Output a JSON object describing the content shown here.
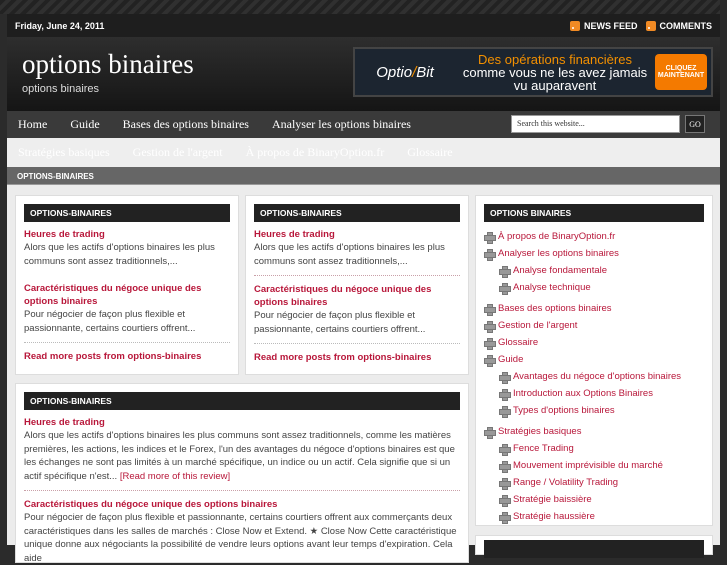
{
  "topbar": {
    "date": "Friday, June 24, 2011",
    "news_feed": "NEWS FEED",
    "comments": "COMMENTS"
  },
  "header": {
    "title": "options binaires",
    "tagline": "options binaires"
  },
  "ad": {
    "logo_a": "Optio",
    "logo_b": "Bit",
    "line1": "Des opérations financières",
    "line2": "comme vous ne les avez jamais",
    "line3": "vu auparavent",
    "button": "CLIQUEZ MAINTENANT"
  },
  "nav": {
    "items": [
      "Home",
      "Guide",
      "Bases des options binaires",
      "Analyser les options binaires"
    ],
    "search_placeholder": "Search this website...",
    "go": "GO"
  },
  "subnav": {
    "items": [
      "Stratégies basiques",
      "Gestion de l'argent",
      "À propos de BinaryOption.fr",
      "Glossaire"
    ]
  },
  "breadcrumb": "OPTIONS-BINAIRES",
  "box_small": {
    "heading": "OPTIONS-BINAIRES",
    "post1_title": "Heures de trading",
    "post1_excerpt": "Alors que les actifs d'options binaires les plus communs sont assez traditionnels,...",
    "post2_title": "Caractéristiques du négoce unique des options binaires",
    "post2_excerpt": "Pour négocier de façon plus flexible et passionnante, certains courtiers offrent...",
    "more": "Read more posts from options-binaires"
  },
  "box_wide": {
    "heading": "OPTIONS-BINAIRES",
    "post1_title": "Heures de trading",
    "post1_excerpt": "Alors que les actifs d'options binaires les plus communs sont assez traditionnels, comme les matières premières, les actions, les indices et le Forex, l'un des avantages du négoce d'options binaires est que les échanges ne sont pas limités à un marché spécifique, un indice ou un actif. Cela signifie que si un actif spécifique n'est...",
    "read_more": "[Read more of this review]",
    "post2_title": "Caractéristiques du négoce unique des options binaires",
    "post2_excerpt": "Pour négocier de façon plus flexible et passionnante, certains courtiers offrent aux commerçants deux caractéristiques dans les salles de marchés : Close Now et Extend. ★   Close Now Cette caractéristique unique donne aux négociants la possibilité de vendre leurs options avant leur temps d'expiration. Cela aide"
  },
  "sidebar": {
    "heading": "OPTIONS BINAIRES",
    "items": [
      {
        "label": "À propos de BinaryOption.fr",
        "sub": false
      },
      {
        "label": "Analyser les options binaires",
        "sub": false
      },
      {
        "label": "Analyse fondamentale",
        "sub": true
      },
      {
        "label": "Analyse technique",
        "sub": true
      },
      {
        "label": "Bases des options binaires",
        "sub": false
      },
      {
        "label": "Gestion de l'argent",
        "sub": false
      },
      {
        "label": "Glossaire",
        "sub": false
      },
      {
        "label": "Guide",
        "sub": false
      },
      {
        "label": "Avantages du négoce d'options binaires",
        "sub": true
      },
      {
        "label": "Introduction aux Options Binaires",
        "sub": true
      },
      {
        "label": "Types d'options binaires",
        "sub": true
      },
      {
        "label": "Stratégies basiques",
        "sub": false
      },
      {
        "label": "Fence Trading",
        "sub": true
      },
      {
        "label": "Mouvement imprévisible du marché",
        "sub": true
      },
      {
        "label": "Range / Volatility Trading",
        "sub": true
      },
      {
        "label": "Stratégie baissière",
        "sub": true
      },
      {
        "label": "Stratégie haussière",
        "sub": true
      }
    ]
  }
}
